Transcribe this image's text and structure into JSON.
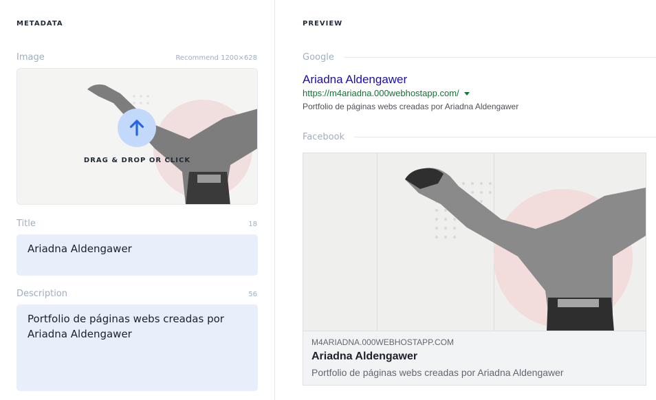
{
  "metadata": {
    "heading": "METADATA",
    "image": {
      "label": "Image",
      "hint": "Recommend 1200×628",
      "drop_text": "DRAG & DROP OR CLICK",
      "upload_icon": "arrow-up-icon"
    },
    "title": {
      "label": "Title",
      "count": "18",
      "value": "Ariadna Aldengawer"
    },
    "description": {
      "label": "Description",
      "count": "56",
      "value": "Portfolio de páginas webs creadas por Ariadna Aldengawer"
    }
  },
  "preview": {
    "heading": "PREVIEW",
    "google": {
      "label": "Google",
      "title": "Ariadna Aldengawer",
      "url": "https://m4ariadna.000webhostapp.com/",
      "description": "Portfolio de páginas webs creadas por Ariadna Aldengawer"
    },
    "facebook": {
      "label": "Facebook",
      "domain": "M4ARIADNA.000WEBHOSTAPP.COM",
      "title": "Ariadna Aldengawer",
      "description": "Portfolio de páginas webs creadas por Ariadna Aldengawer"
    }
  },
  "colors": {
    "accent": "#3b82f6",
    "input_bg": "#e8effb",
    "label": "#a0aec0",
    "google_title": "#1a0dab",
    "google_url": "#137333"
  }
}
